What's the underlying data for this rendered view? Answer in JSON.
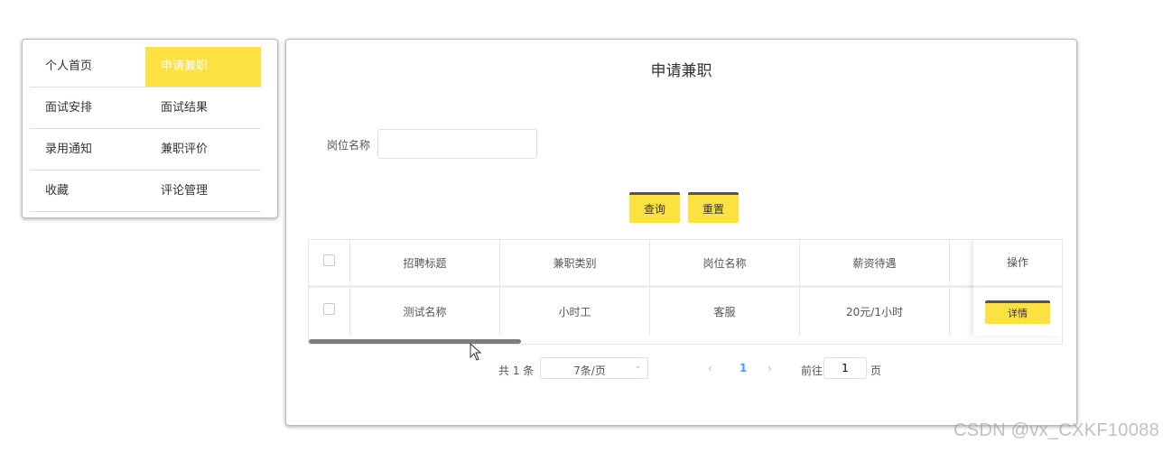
{
  "menu": {
    "items": [
      [
        {
          "label": "个人首页",
          "active": false
        },
        {
          "label": "申请兼职",
          "active": true
        }
      ],
      [
        {
          "label": "面试安排",
          "active": false
        },
        {
          "label": "面试结果",
          "active": false
        }
      ],
      [
        {
          "label": "录用通知",
          "active": false
        },
        {
          "label": "兼职评价",
          "active": false
        }
      ],
      [
        {
          "label": "收藏",
          "active": false
        },
        {
          "label": "评论管理",
          "active": false
        }
      ]
    ],
    "active_color": "#fde140"
  },
  "page": {
    "title": "申请兼职"
  },
  "search": {
    "label": "岗位名称",
    "value": "",
    "placeholder": ""
  },
  "buttons": {
    "query": "查询",
    "reset": "重置",
    "detail": "详情"
  },
  "table": {
    "columns": [
      "招聘标题",
      "兼职类别",
      "岗位名称",
      "薪资待遇"
    ],
    "action_column": "操作",
    "rows": [
      {
        "title": "测试名称",
        "category": "小时工",
        "position": "客服",
        "salary": "20元/1小时"
      }
    ]
  },
  "pagination": {
    "total": "共 1 条",
    "page_size": "7条/页",
    "current_page": "1",
    "goto_label": "前往",
    "goto_value": "1",
    "goto_suffix": "页"
  },
  "watermark": "CSDN @vx_CXKF10088"
}
